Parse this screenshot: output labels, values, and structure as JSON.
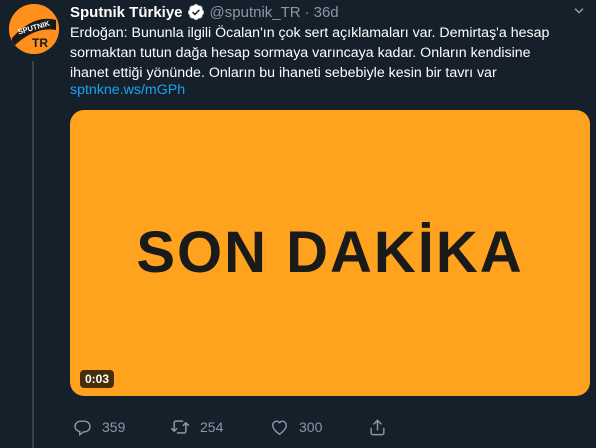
{
  "tweet": {
    "author": {
      "avatar_icon": "sputnik-logo-icon",
      "avatar_text_top": "SPUTNIK",
      "avatar_text_bottom": "TR",
      "display_name": "Sputnik Türkiye",
      "verified_icon": "verified-badge-icon",
      "handle": "@sputnik_TR",
      "separator": "·",
      "time": "36d"
    },
    "text_lines": [
      "Erdoğan: Bununla ilgili Öcalan'ın çok sert açıklamaları var. Demirtaş'a hesap",
      "sormaktan tutun dağa hesap sormaya varıncaya kadar. Onların kendisine",
      "ihanet ettiği yönünde. Onların bu ihaneti sebebiyle kesin bir tavrı var"
    ],
    "link": "sptnkne.ws/mGPh",
    "media": {
      "headline": "SON DAKİKA",
      "duration": "0:03",
      "background_color": "#ffa21e"
    },
    "actions": {
      "reply_count": "359",
      "retweet_count": "254",
      "like_count": "300"
    }
  },
  "colors": {
    "background": "#15202b",
    "secondary_text": "#8899a6",
    "link": "#1da1f2"
  }
}
